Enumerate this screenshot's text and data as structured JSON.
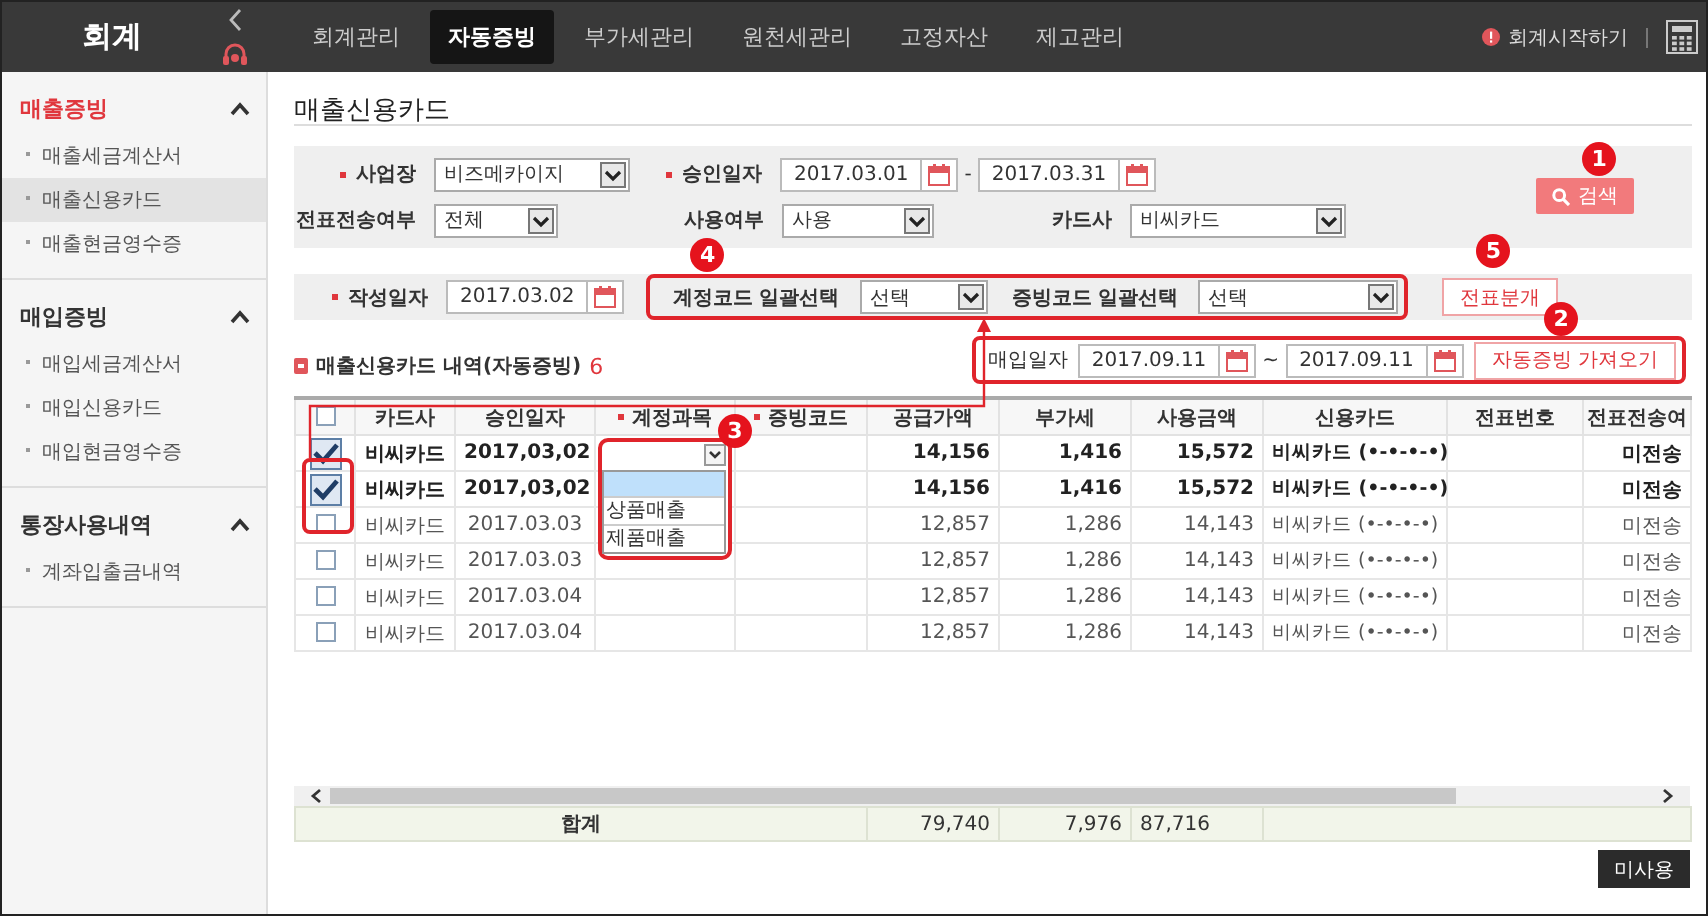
{
  "header": {
    "app_title": "회계",
    "nav_tabs": [
      {
        "label": "회계관리",
        "selected": false
      },
      {
        "label": "자동증빙",
        "selected": true
      },
      {
        "label": "부가세관리",
        "selected": false
      },
      {
        "label": "원천세관리",
        "selected": false
      },
      {
        "label": "고정자산",
        "selected": false
      },
      {
        "label": "제고관리",
        "selected": false
      }
    ],
    "start_link": "회계시작하기"
  },
  "sidebar": [
    {
      "title": "매출증빙",
      "selected": true,
      "expanded": true,
      "items": [
        {
          "label": "매출세금계산서",
          "selected": false
        },
        {
          "label": "매출신용카드",
          "selected": true
        },
        {
          "label": "매출현금영수증",
          "selected": false
        }
      ]
    },
    {
      "title": "매입증빙",
      "selected": false,
      "expanded": true,
      "items": [
        {
          "label": "매입세금계산서",
          "selected": false
        },
        {
          "label": "매입신용카드",
          "selected": false
        },
        {
          "label": "매입현금영수증",
          "selected": false
        }
      ]
    },
    {
      "title": "통장사용내역",
      "selected": false,
      "expanded": true,
      "items": [
        {
          "label": "계좌입출금내역",
          "selected": false
        }
      ]
    }
  ],
  "page_title": "매출신용카드",
  "search_panel": {
    "rows": [
      [
        {
          "kind": "select",
          "label": "사업장",
          "required": true,
          "value": "비즈메카이지"
        },
        {
          "kind": "date_range",
          "label": "승인일자",
          "required": true,
          "from": "2017.03.01",
          "separator": "-",
          "to": "2017.03.31"
        }
      ],
      [
        {
          "kind": "select",
          "label": "전표전송여부",
          "required": false,
          "value": "전체"
        },
        {
          "kind": "select",
          "label": "사용여부",
          "required": false,
          "value": "사용"
        },
        {
          "kind": "select",
          "label": "카드사",
          "required": false,
          "value": "비씨카드"
        }
      ]
    ],
    "search_button": "검색",
    "callout": "1"
  },
  "bulk_panel": {
    "date_label": "작성일자",
    "date_required": true,
    "date": "2017.03.02",
    "bulk_selects": [
      {
        "label": "계정코드 일괄선택",
        "value": "선택"
      },
      {
        "label": "증빙코드 일괄선택",
        "value": "선택"
      }
    ],
    "bulk_callout": "4",
    "journal_button": "전표분개",
    "journal_callout": "5"
  },
  "list": {
    "title": "매출신용카드 내역(자동증빙)",
    "count": "6",
    "import": {
      "label": "매입일자",
      "from": "2017.09.11",
      "separator": "~",
      "to": "2017.09.11",
      "button": "자동증빙 가져오기",
      "callout": "2"
    }
  },
  "table": {
    "header_checked": false,
    "columns": [
      {
        "label": "카드사",
        "required": false
      },
      {
        "label": "승인일자",
        "required": false
      },
      {
        "label": "계정과목",
        "required": true
      },
      {
        "label": "증빙코드",
        "required": true
      },
      {
        "label": "공급가액",
        "required": false
      },
      {
        "label": "부가세",
        "required": false
      },
      {
        "label": "사용금액",
        "required": false
      },
      {
        "label": "신용카드",
        "required": false
      },
      {
        "label": "전표번호",
        "required": false
      },
      {
        "label": "전표전송여",
        "required": false
      }
    ],
    "rows": [
      {
        "checked": true,
        "card_company": "비씨카드",
        "date": "2017,03,02",
        "account_dropdown": {
          "open": true,
          "options": [
            "상품매출",
            "제품매출"
          ],
          "callout": "3"
        },
        "supply": "14,156",
        "vat": "1,416",
        "amount": "15,572",
        "card": "비씨카드 (•-•-•-•)",
        "status": "미전송"
      },
      {
        "checked": true,
        "card_company": "비씨카드",
        "date": "2017,03,02",
        "supply": "14,156",
        "vat": "1,416",
        "amount": "15,572",
        "card": "비씨카드 (•-•-•-•)",
        "status": "미전송"
      },
      {
        "checked": false,
        "card_company": "비씨카드",
        "date": "2017.03.03",
        "supply": "12,857",
        "vat": "1,286",
        "amount": "14,143",
        "card": "비씨카드 (•-•-•-•)",
        "status": "미전송"
      },
      {
        "checked": false,
        "card_company": "비씨카드",
        "date": "2017.03.03",
        "supply": "12,857",
        "vat": "1,286",
        "amount": "14,143",
        "card": "비씨카드 (•-•-•-•)",
        "status": "미전송"
      },
      {
        "checked": false,
        "card_company": "비씨카드",
        "date": "2017.03.04",
        "supply": "12,857",
        "vat": "1,286",
        "amount": "14,143",
        "card": "비씨카드 (•-•-•-•)",
        "status": "미전송"
      },
      {
        "checked": false,
        "card_company": "비씨카드",
        "date": "2017.03.04",
        "supply": "12,857",
        "vat": "1,286",
        "amount": "14,143",
        "card": "비씨카드 (•-•-•-•)",
        "status": "미전송"
      }
    ],
    "totals": {
      "label": "합계",
      "supply": "79,740",
      "vat": "7,976",
      "amount": "87,716"
    }
  },
  "unused_button": "미사용"
}
